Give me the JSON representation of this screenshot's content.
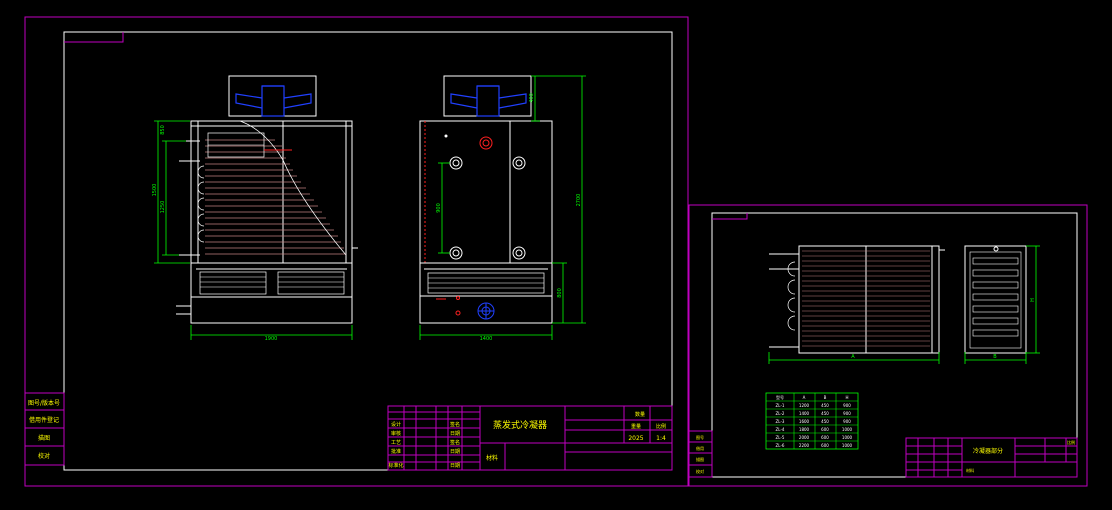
{
  "colors": {
    "background": "#000000",
    "frame": "#c000c0",
    "white": "#ffffff",
    "green": "#00ff00",
    "yellow": "#ffff00",
    "blue": "#2040ff",
    "red": "#ff2020",
    "coil": "#c08080"
  },
  "sheet1": {
    "title_block": {
      "drawing_title": "蒸发式冷凝器",
      "scale_label": "比例",
      "quantity_label": "数量",
      "weight_label": "重量",
      "scale_value": "1:4",
      "weight_value": "2025",
      "material_label": "材料",
      "rows": [
        "设计",
        "审核",
        "工艺",
        "批准",
        "标准化"
      ],
      "rows_right": [
        "签名",
        "日期",
        "签名",
        "日期",
        "日期"
      ]
    },
    "side_table": [
      "图号/版本号",
      "借用件登记",
      "描图",
      "校对"
    ],
    "dims": {
      "front_width": "1900",
      "side_width": "1400",
      "front_height_a": "1500",
      "front_height_b": "1250",
      "front_height_c": "850",
      "side_height_total": "2700",
      "side_height_top": "400",
      "side_height_mid": "900",
      "side_height_bottom": "800"
    }
  },
  "sheet2": {
    "title_block": {
      "drawing_title": "冷凝器部分",
      "scale_label": "比例",
      "material_label": "材料"
    },
    "side_table": [
      "图号",
      "借用",
      "描图",
      "校对"
    ],
    "dims": {
      "coil_width": "A",
      "coil_side_width": "B",
      "coil_height": "H"
    },
    "table": {
      "header": [
        "型号",
        "A",
        "B",
        "H"
      ],
      "rows": [
        [
          "ZL-1",
          "1200",
          "450",
          "900"
        ],
        [
          "ZL-2",
          "1400",
          "450",
          "900"
        ],
        [
          "ZL-3",
          "1600",
          "450",
          "900"
        ],
        [
          "ZL-4",
          "1800",
          "600",
          "1000"
        ],
        [
          "ZL-5",
          "2000",
          "600",
          "1000"
        ],
        [
          "ZL-6",
          "2200",
          "600",
          "1000"
        ]
      ]
    }
  }
}
